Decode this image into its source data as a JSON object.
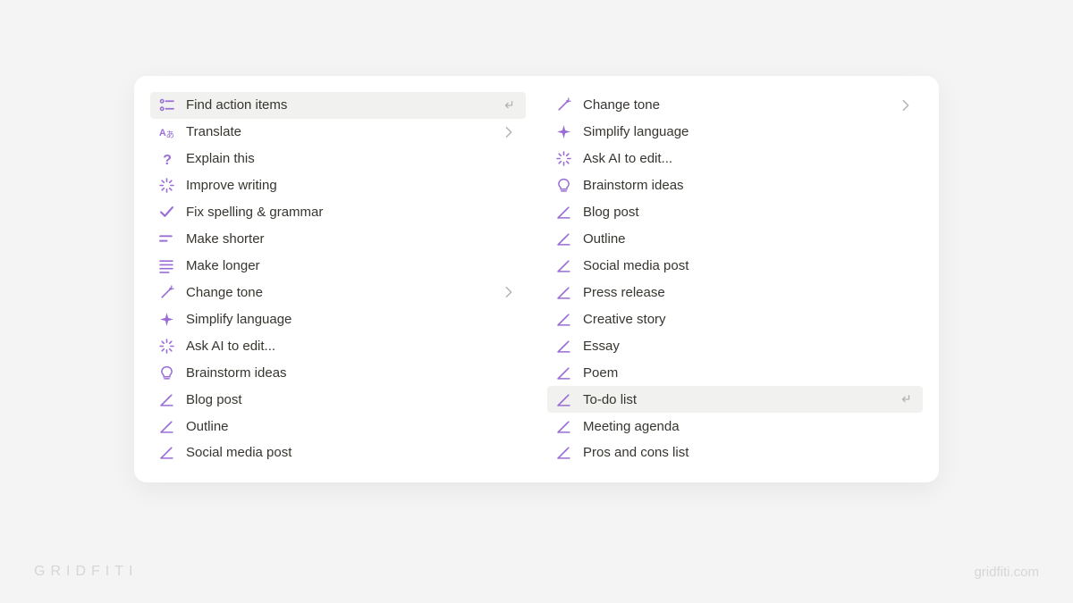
{
  "colors": {
    "accent": "#9a6dd7"
  },
  "watermark": {
    "brand": "GRIDFITI",
    "url": "gridfiti.com"
  },
  "menu": {
    "left": [
      {
        "label": "Find action items",
        "icon": "list-check-icon",
        "selected": true,
        "trail": "enter"
      },
      {
        "label": "Translate",
        "icon": "translate-icon",
        "selected": false,
        "trail": "chevron"
      },
      {
        "label": "Explain this",
        "icon": "question-icon",
        "selected": false,
        "trail": null
      },
      {
        "label": "Improve writing",
        "icon": "sparkle-burst-icon",
        "selected": false,
        "trail": null
      },
      {
        "label": "Fix spelling & grammar",
        "icon": "check-icon",
        "selected": false,
        "trail": null
      },
      {
        "label": "Make shorter",
        "icon": "lines-short-icon",
        "selected": false,
        "trail": null
      },
      {
        "label": "Make longer",
        "icon": "lines-long-icon",
        "selected": false,
        "trail": null
      },
      {
        "label": "Change tone",
        "icon": "wand-icon",
        "selected": false,
        "trail": "chevron"
      },
      {
        "label": "Simplify language",
        "icon": "sparkle-icon",
        "selected": false,
        "trail": null
      },
      {
        "label": "Ask AI to edit...",
        "icon": "sparkle-burst-icon",
        "selected": false,
        "trail": null
      },
      {
        "label": "Brainstorm ideas",
        "icon": "bulb-icon",
        "selected": false,
        "trail": null
      },
      {
        "label": "Blog post",
        "icon": "pencil-draft-icon",
        "selected": false,
        "trail": null
      },
      {
        "label": "Outline",
        "icon": "pencil-draft-icon",
        "selected": false,
        "trail": null
      },
      {
        "label": "Social media post",
        "icon": "pencil-draft-icon",
        "selected": false,
        "trail": null
      }
    ],
    "right": [
      {
        "label": "Change tone",
        "icon": "wand-icon",
        "selected": false,
        "trail": "chevron"
      },
      {
        "label": "Simplify language",
        "icon": "sparkle-icon",
        "selected": false,
        "trail": null
      },
      {
        "label": "Ask AI to edit...",
        "icon": "sparkle-burst-icon",
        "selected": false,
        "trail": null
      },
      {
        "label": "Brainstorm ideas",
        "icon": "bulb-icon",
        "selected": false,
        "trail": null
      },
      {
        "label": "Blog post",
        "icon": "pencil-draft-icon",
        "selected": false,
        "trail": null
      },
      {
        "label": "Outline",
        "icon": "pencil-draft-icon",
        "selected": false,
        "trail": null
      },
      {
        "label": "Social media post",
        "icon": "pencil-draft-icon",
        "selected": false,
        "trail": null
      },
      {
        "label": "Press release",
        "icon": "pencil-draft-icon",
        "selected": false,
        "trail": null
      },
      {
        "label": "Creative story",
        "icon": "pencil-draft-icon",
        "selected": false,
        "trail": null
      },
      {
        "label": "Essay",
        "icon": "pencil-draft-icon",
        "selected": false,
        "trail": null
      },
      {
        "label": "Poem",
        "icon": "pencil-draft-icon",
        "selected": false,
        "trail": null
      },
      {
        "label": "To-do list",
        "icon": "pencil-draft-icon",
        "selected": true,
        "trail": "enter"
      },
      {
        "label": "Meeting agenda",
        "icon": "pencil-draft-icon",
        "selected": false,
        "trail": null
      },
      {
        "label": "Pros and cons list",
        "icon": "pencil-draft-icon",
        "selected": false,
        "trail": null
      }
    ]
  }
}
